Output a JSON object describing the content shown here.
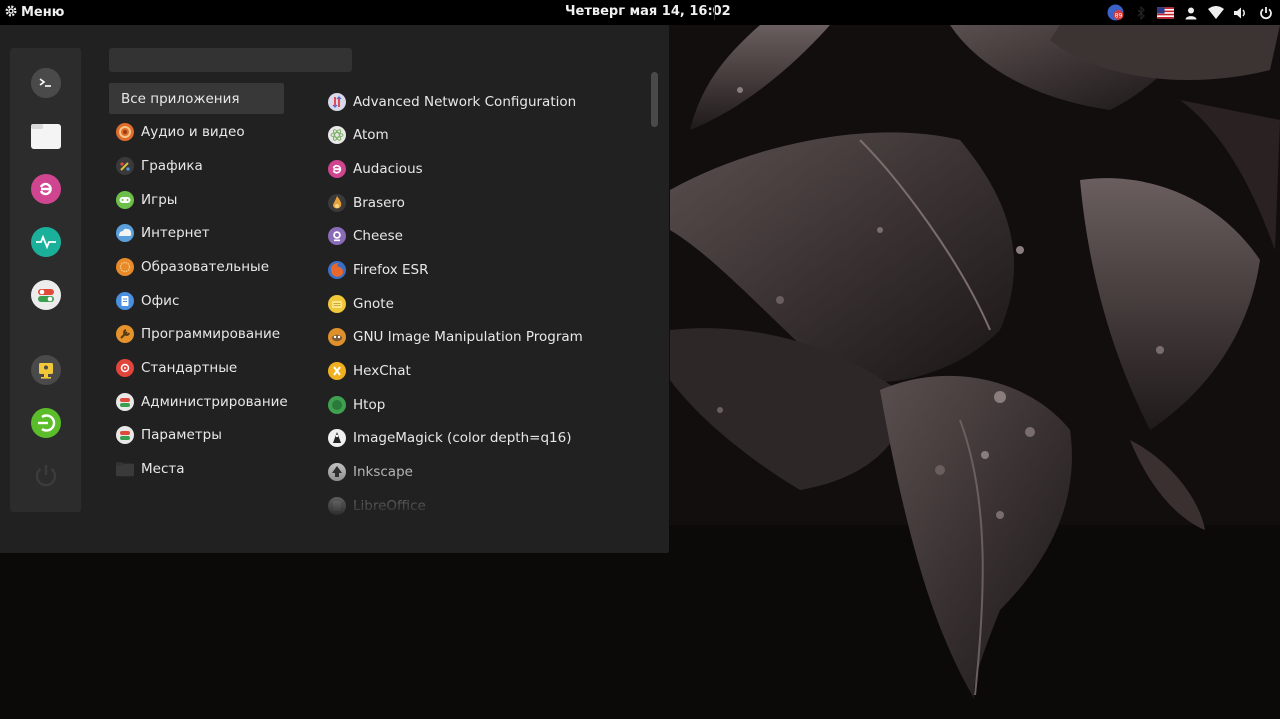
{
  "panel": {
    "menu_label": "Меню",
    "clock": "Четверг мая 14, 16:02",
    "tray_badge": "89"
  },
  "search": {
    "value": "",
    "placeholder": ""
  },
  "favorites": [
    {
      "name": "terminal",
      "icon": "terminal-icon"
    },
    {
      "name": "files",
      "icon": "folder-icon"
    },
    {
      "name": "audacious",
      "icon": "audacious-icon"
    },
    {
      "name": "system-monitor",
      "icon": "activity-icon"
    },
    {
      "name": "settings",
      "icon": "toggle-icon"
    },
    {
      "name": "lock-screen",
      "icon": "lock-screen-icon"
    },
    {
      "name": "logout",
      "icon": "logout-icon"
    },
    {
      "name": "shutdown",
      "icon": "power-icon"
    }
  ],
  "categories": [
    {
      "label": "Все приложения",
      "icon": "",
      "color": ""
    },
    {
      "label": "Аудио и видео",
      "icon": "audio-video-icon",
      "color": "#e06c2b"
    },
    {
      "label": "Графика",
      "icon": "graphics-icon",
      "color": "#3a3a3a"
    },
    {
      "label": "Игры",
      "icon": "games-icon",
      "color": "#6cc04a"
    },
    {
      "label": "Интернет",
      "icon": "internet-icon",
      "color": "#5aa0dc"
    },
    {
      "label": "Образовательные",
      "icon": "education-icon",
      "color": "#e88a2a"
    },
    {
      "label": "Офис",
      "icon": "office-icon",
      "color": "#4a8fe0"
    },
    {
      "label": "Программирование",
      "icon": "programming-icon",
      "color": "#e6932c"
    },
    {
      "label": "Стандартные",
      "icon": "accessories-icon",
      "color": "#e0443a"
    },
    {
      "label": "Администрирование",
      "icon": "administration-icon",
      "color": "#e8e8e8"
    },
    {
      "label": "Параметры",
      "icon": "preferences-icon",
      "color": "#e8e8e8"
    },
    {
      "label": "Места",
      "icon": "places-icon",
      "color": "#3a3a3a"
    }
  ],
  "apps": [
    {
      "label": "Advanced Network Configuration",
      "icon": "network-config-icon",
      "color": "#d8d8e8"
    },
    {
      "label": "Atom",
      "icon": "atom-icon",
      "color": "#e8e8e8"
    },
    {
      "label": "Audacious",
      "icon": "audacious-icon",
      "color": "#d0458f"
    },
    {
      "label": "Brasero",
      "icon": "brasero-icon",
      "color": "#e8a23a"
    },
    {
      "label": "Cheese",
      "icon": "cheese-icon",
      "color": "#8a6bb8"
    },
    {
      "label": "Firefox ESR",
      "icon": "firefox-icon",
      "color": "#e8672a"
    },
    {
      "label": "Gnote",
      "icon": "gnote-icon",
      "color": "#f0c83a"
    },
    {
      "label": "GNU Image Manipulation Program",
      "icon": "gimp-icon",
      "color": "#e0902a"
    },
    {
      "label": "HexChat",
      "icon": "hexchat-icon",
      "color": "#f0b020"
    },
    {
      "label": "Htop",
      "icon": "htop-icon",
      "color": "#3ea050"
    },
    {
      "label": "ImageMagick (color depth=q16)",
      "icon": "imagemagick-icon",
      "color": "#e8e8e8"
    },
    {
      "label": "Inkscape",
      "icon": "inkscape-icon",
      "color": "#d8d8d8"
    },
    {
      "label": "LibreOffice",
      "icon": "libreoffice-icon",
      "color": "#d0d0d0"
    }
  ]
}
